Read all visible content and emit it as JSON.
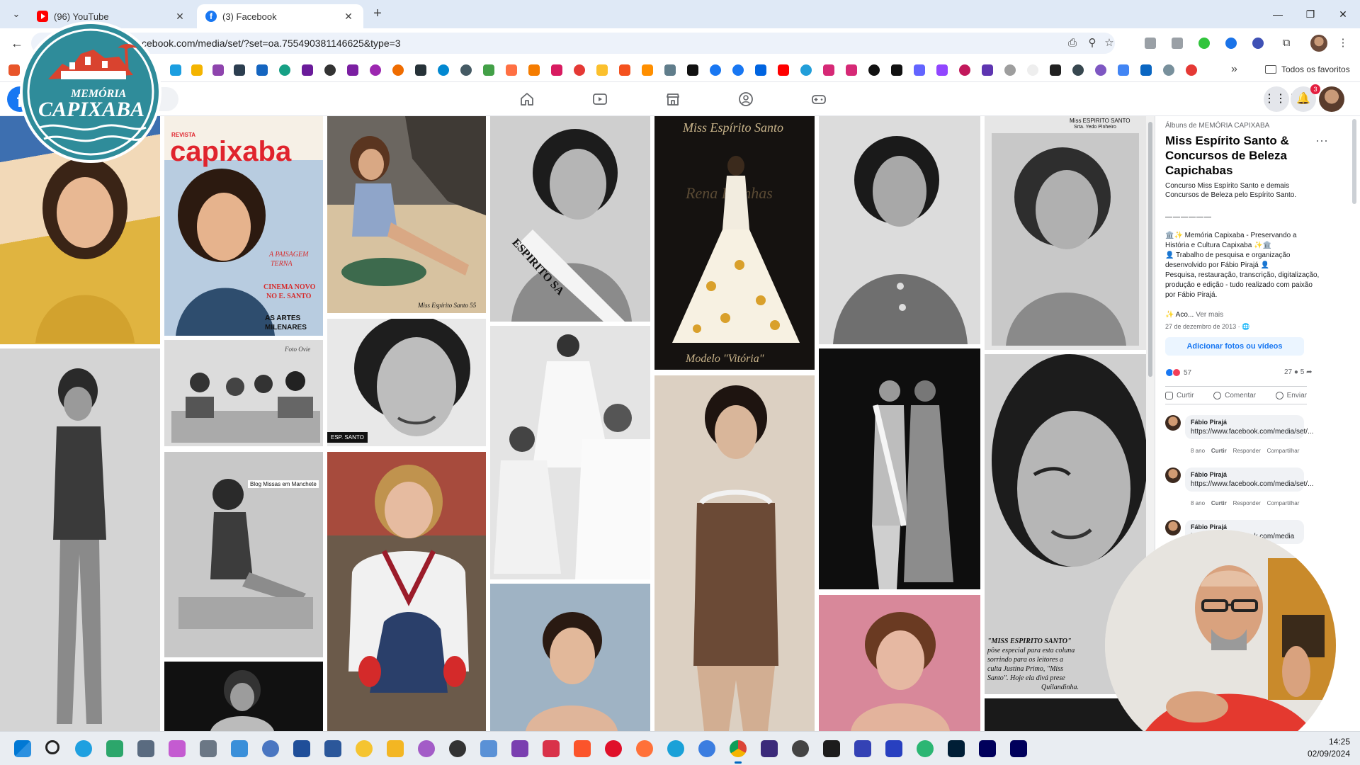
{
  "browser": {
    "tabs": [
      {
        "label": "(96) YouTube",
        "favicon": "youtube-icon",
        "active": false
      },
      {
        "label": "(3) Facebook",
        "favicon": "facebook-icon",
        "active": true
      }
    ],
    "new_tab_label": "+",
    "url": "cebook.com/media/set/?set=oa.755490381146625&type=3",
    "bookmarks_folder_label": "Todos os favoritos",
    "bookmarks_more": "»"
  },
  "facebook_header": {
    "logo": "f",
    "nav_icons": [
      "home-icon",
      "watch-icon",
      "marketplace-icon",
      "groups-icon",
      "gaming-icon"
    ],
    "notification_count": "3"
  },
  "overlay_logo": {
    "line1": "MEMÓRIA",
    "line2": "CAPIXABA"
  },
  "photos": {
    "magazine_brand": "capixaba",
    "magazine_revista": "REVISTA",
    "magazine_tag1": "A PAISAGEM",
    "magazine_tag2": "TERNA",
    "magazine_tag3": "CINEMA NOVO",
    "magazine_tag4": "NO E. SANTO",
    "magazine_tag5": "AS ARTES",
    "magazine_tag6": "MILENARES",
    "beach_caption": "Miss Espírito Santo 55",
    "sash_text": "ESPIRITO SA",
    "portrait_tag": "ESP. SANTO",
    "blog_tag": "Blog Missas em Manchete",
    "press_tag": "Foto Ovie",
    "gown_top": "Miss Espírito Santo",
    "gown_middle": "Rena Rainhas",
    "gown_bottom": "Modelo \"Vitória\"",
    "clip_header1": "Miss ESPIRITO SANTO",
    "clip_header2": "Srta. Yedo Pinheiro",
    "clip_text1": "\"MISS ESPIRITO SANTO\"",
    "clip_text2": "pôse especial para esta coluna",
    "clip_text3": "sorrindo para os leitores a",
    "clip_text4": "culta Justina Primo, \"Miss",
    "clip_text5": "Santo\". Hoje ela divá prese",
    "clip_text6": "Quilandinha."
  },
  "album_panel": {
    "album_label": "Álbuns de MEMÓRIA CAPIXABA",
    "title": "Miss Espírito Santo & Concursos de Beleza Capichabas",
    "more": "···",
    "description": "Concurso Miss Espírito Santo e demais Concursos de Beleza pelo Espírito Santo.",
    "separator": "——————",
    "body_lines": [
      "🏛️✨ Memória Capixaba - Preservando a História e Cultura Capixaba ✨🏛️",
      "👤 Trabalho de pesquisa e organização desenvolvido por Fábio Pirajá 👤",
      "Pesquisa, restauração, transcrição, digitalização, produção e edição - tudo realizado com paixão por Fábio Pirajá."
    ],
    "see_more_prefix": "✨ Aco...",
    "see_more": "Ver mais",
    "date": "27 de dezembro de 2013 · 🌐",
    "add_button": "Adicionar fotos ou vídeos",
    "reactions_count": "57",
    "comments_count": "27",
    "shares_count": "5",
    "actions": {
      "like": "Curtir",
      "comment": "Comentar",
      "send": "Enviar"
    },
    "comments": [
      {
        "name": "Fábio Pirajá",
        "text": "https://www.facebook.com/media/set/...",
        "age": "8 ano",
        "like": "Curtir",
        "reply": "Responder",
        "share": "Compartilhar"
      },
      {
        "name": "Fábio Pirajá",
        "text": "https://www.facebook.com/media/set/...",
        "age": "8 ano",
        "like": "Curtir",
        "reply": "Responder",
        "share": "Compartilhar"
      },
      {
        "name": "Fábio Pirajá",
        "text": "https://www.facebook.com/media",
        "age": "",
        "like": "",
        "reply": "",
        "share": ""
      }
    ]
  },
  "taskbar": {
    "time": "14:25",
    "date": "02/09/2024"
  },
  "colors": {
    "facebook_blue": "#1877f2",
    "tabstrip": "#dfe9f6",
    "taskbar": "#e9edf2",
    "magazine_red": "#e0242d",
    "logo_teal": "#2f8c9a",
    "logo_red": "#d9432f"
  }
}
